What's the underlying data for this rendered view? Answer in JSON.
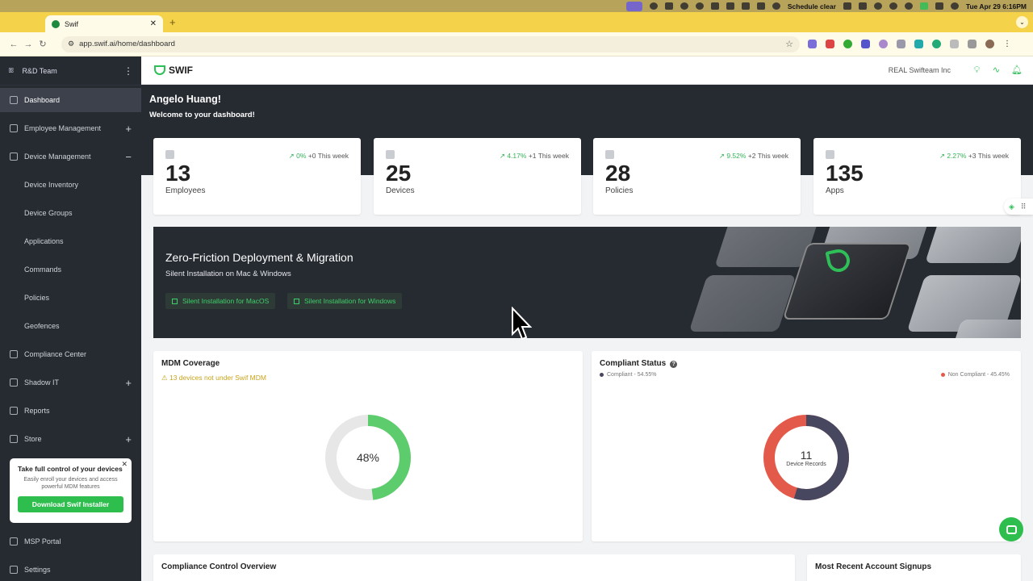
{
  "menubar": {
    "schedule": "Schedule clear",
    "datetime": "Tue Apr 29  6:16PM"
  },
  "browser": {
    "tab_title": "Swif",
    "url": "app.swif.ai/home/dashboard"
  },
  "sidebar": {
    "team": "R&D Team",
    "items": [
      {
        "label": "Dashboard",
        "icon": "home-icon"
      },
      {
        "label": "Employee Management",
        "icon": "people-icon"
      },
      {
        "label": "Device Management",
        "icon": "device-icon"
      },
      {
        "label": "Compliance Center",
        "icon": "compliance-icon"
      },
      {
        "label": "Shadow IT",
        "icon": "shadow-icon"
      },
      {
        "label": "Reports",
        "icon": "report-icon"
      },
      {
        "label": "Store",
        "icon": "store-icon"
      },
      {
        "label": "MSP Portal",
        "icon": "portal-icon"
      },
      {
        "label": "Settings",
        "icon": "gear-icon"
      }
    ],
    "subitems": [
      "Device Inventory",
      "Device Groups",
      "Applications",
      "Commands",
      "Policies",
      "Geofences"
    ],
    "promo": {
      "title": "Take full control of your devices",
      "text": "Easily enroll your devices and access powerful MDM features",
      "button": "Download Swif Installer"
    }
  },
  "topbar": {
    "logo": "SWIF",
    "org": "REAL Swifteam Inc"
  },
  "header": {
    "greeting": "Angelo Huang!",
    "welcome": "Welcome to your dashboard!"
  },
  "stats": [
    {
      "pct": "0%",
      "week": "+0 This week",
      "value": "13",
      "label": "Employees"
    },
    {
      "pct": "4.17%",
      "week": "+1 This week",
      "value": "25",
      "label": "Devices"
    },
    {
      "pct": "9.52%",
      "week": "+2 This week",
      "value": "28",
      "label": "Policies"
    },
    {
      "pct": "2.27%",
      "week": "+3 This week",
      "value": "135",
      "label": "Apps"
    }
  ],
  "banner": {
    "title": "Zero-Friction Deployment & Migration",
    "subtitle": "Silent Installation on Mac & Windows",
    "btn_mac": "Silent Installation for MacOS",
    "btn_win": "Silent Installation for Windows"
  },
  "mdm": {
    "title": "MDM Coverage",
    "warning": "13 devices not under Swif MDM",
    "percent_label": "48%",
    "fraction": 0.48,
    "color": "#5ccc6c"
  },
  "compliance": {
    "title": "Compliant Status",
    "compliant_label": "Compliant - 54.55%",
    "noncompliant_label": "Non Compliant - 45.45%",
    "compliant_fraction": 0.5455,
    "compliant_color": "#474760",
    "noncompliant_color": "#e35a4a",
    "count": "11",
    "count_label": "Device Records"
  },
  "bottom": {
    "left_title": "Compliance Control Overview",
    "right_title": "Most Recent Account Signups"
  }
}
